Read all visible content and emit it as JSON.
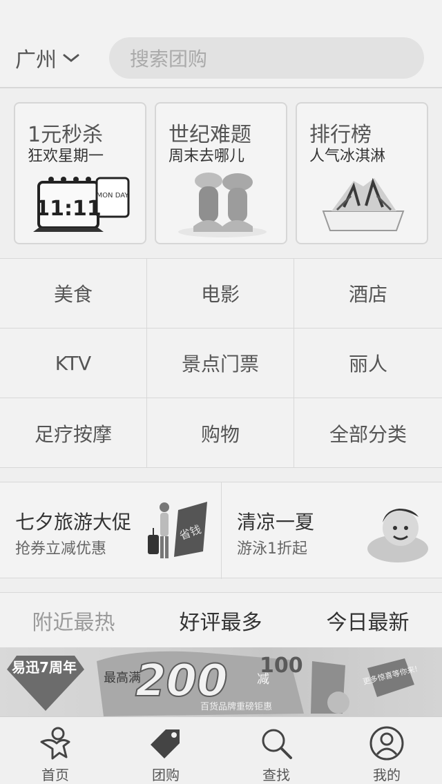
{
  "header": {
    "city": "广州",
    "search_placeholder": "搜索团购"
  },
  "promo_cards": [
    {
      "title": "1元秒杀",
      "subtitle": "狂欢星期一",
      "icon": "calendar-11-11",
      "calendar_digits": "11:11",
      "calendar_day": "MON DAY"
    },
    {
      "title": "世纪难题",
      "subtitle": "周末去哪儿",
      "icon": "couple-photo"
    },
    {
      "title": "排行榜",
      "subtitle": "人气冰淇淋",
      "icon": "shaved-ice"
    }
  ],
  "categories": [
    "美食",
    "电影",
    "酒店",
    "KTV",
    "景点门票",
    "丽人",
    "足疗按摩",
    "购物",
    "全部分类"
  ],
  "banners": [
    {
      "title": "七夕旅游大促",
      "subtitle": "抢券立减优惠",
      "icon": "traveler-with-luggage",
      "tag": "省钱"
    },
    {
      "title": "清凉一夏",
      "subtitle": "游泳1折起",
      "icon": "child-swimming"
    }
  ],
  "sort_tabs": [
    {
      "label": "附近最热",
      "active": false
    },
    {
      "label": "好评最多",
      "active": true
    },
    {
      "label": "今日最新",
      "active": true
    }
  ],
  "ad": {
    "brand": "易迅7周年",
    "line1": "最高满",
    "amount": "200",
    "minus": "减",
    "discount": "100",
    "sub": "百货品牌重磅钜惠",
    "cta": "更多惊喜等你来!"
  },
  "nav": [
    {
      "label": "首页",
      "icon": "home-person-icon"
    },
    {
      "label": "团购",
      "icon": "tag-icon"
    },
    {
      "label": "查找",
      "icon": "search-icon"
    },
    {
      "label": "我的",
      "icon": "profile-icon"
    }
  ],
  "colors": {
    "background": "#efefef",
    "text_dark": "#333333",
    "text_muted": "#aaaaaa",
    "divider": "#d8d8d8"
  }
}
